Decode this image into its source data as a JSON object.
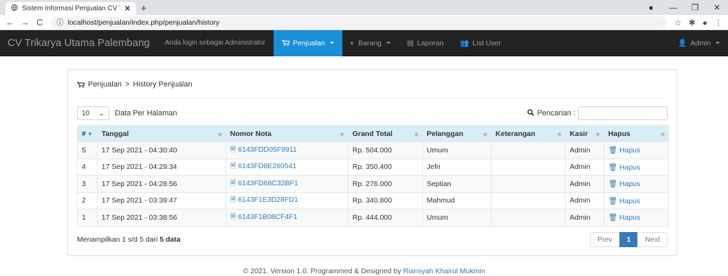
{
  "browser": {
    "tab_title": "Sistem Informasi Penjualan CV Tr",
    "tab_close": "✕",
    "new_tab": "+",
    "url": "localhost/penjualan/index.php/penjualan/history"
  },
  "navbar": {
    "brand": "CV Trikarya Utama Palembang",
    "login_text": "Anda login sebagai Administrator",
    "items": [
      {
        "label": "Penjualan",
        "icon": "cart-icon"
      },
      {
        "label": "Barang",
        "icon": "tag-icon"
      },
      {
        "label": "Laporan",
        "icon": "file-icon"
      },
      {
        "label": "List User",
        "icon": "users-icon"
      }
    ],
    "user": "Admin"
  },
  "breadcrumb": {
    "root": "Penjualan",
    "sep": ">",
    "current": "History Penjualan"
  },
  "controls": {
    "per_page_value": "10",
    "per_page_label": "Data Per Halaman",
    "search_label": "Pencarian :"
  },
  "table": {
    "headers": [
      "#",
      "Tanggal",
      "Nomor Nota",
      "Grand Total",
      "Pelanggan",
      "Keterangan",
      "Kasir",
      "Hapus"
    ],
    "rows": [
      {
        "no": "5",
        "tanggal": "17 Sep 2021 - 04:30:40",
        "nota": "6143FDD05F9911",
        "total": "Rp. 504.000",
        "pelanggan": "Umum",
        "ket": "",
        "kasir": "Admin",
        "hapus": "Hapus"
      },
      {
        "no": "4",
        "tanggal": "17 Sep 2021 - 04:29:34",
        "nota": "6143FD8E260541",
        "total": "Rp. 350.400",
        "pelanggan": "Jefri",
        "ket": "",
        "kasir": "Admin",
        "hapus": "Hapus"
      },
      {
        "no": "3",
        "tanggal": "17 Sep 2021 - 04:28:56",
        "nota": "6143FD68C32BF1",
        "total": "Rp. 276.000",
        "pelanggan": "Septian",
        "ket": "",
        "kasir": "Admin",
        "hapus": "Hapus"
      },
      {
        "no": "2",
        "tanggal": "17 Sep 2021 - 03:39:47",
        "nota": "6143F1E3D28FD1",
        "total": "Rp. 340.800",
        "pelanggan": "Mahmud",
        "ket": "",
        "kasir": "Admin",
        "hapus": "Hapus"
      },
      {
        "no": "1",
        "tanggal": "17 Sep 2021 - 03:38:56",
        "nota": "6143F1B08CF4F1",
        "total": "Rp. 444.000",
        "pelanggan": "Umum",
        "ket": "",
        "kasir": "Admin",
        "hapus": "Hapus"
      }
    ]
  },
  "pagination": {
    "info_prefix": "Menampilkan 1 s/d 5 dari ",
    "info_bold": "5 data",
    "prev": "Prev",
    "current": "1",
    "next": "Next"
  },
  "footer": {
    "text": "© 2021. Version 1.0. Programmed & Designed by ",
    "author": "Riansyah Khairul Mukmin"
  },
  "colors": {
    "navbar_bg": "#222222",
    "active_nav": "#1a8fd8",
    "header_row": "#d9edf7",
    "link": "#337ab7"
  }
}
